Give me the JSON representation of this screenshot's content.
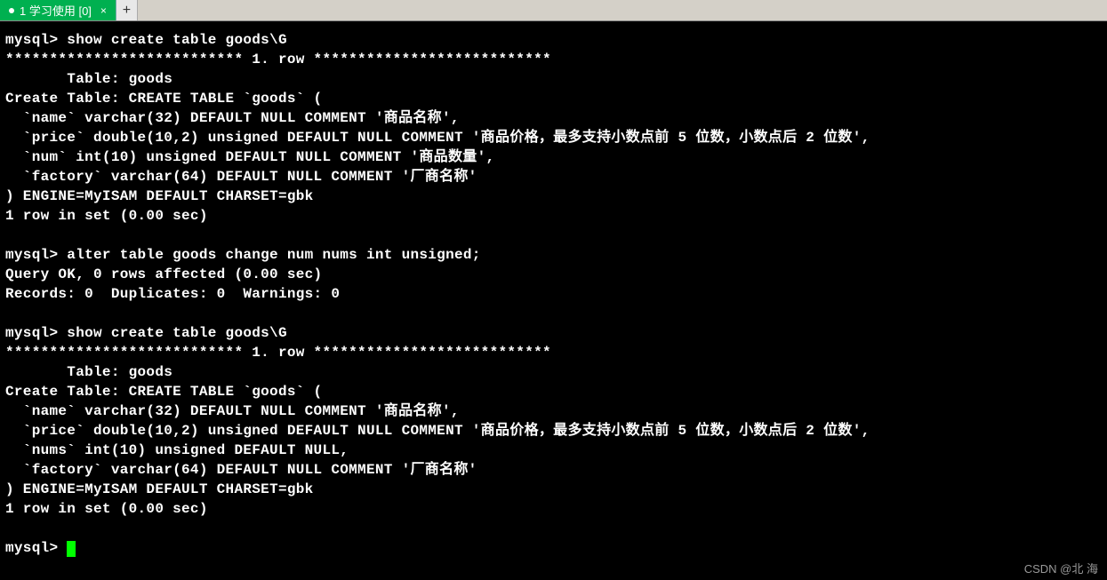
{
  "tab": {
    "label": "1 学习使用 [0]",
    "close_glyph": "×"
  },
  "add_tab_glyph": "+",
  "terminal": {
    "lines": [
      "mysql> show create table goods\\G",
      "*************************** 1. row ***************************",
      "       Table: goods",
      "Create Table: CREATE TABLE `goods` (",
      "  `name` varchar(32) DEFAULT NULL COMMENT '商品名称',",
      "  `price` double(10,2) unsigned DEFAULT NULL COMMENT '商品价格，最多支持小数点前 5 位数，小数点后 2 位数',",
      "  `num` int(10) unsigned DEFAULT NULL COMMENT '商品数量',",
      "  `factory` varchar(64) DEFAULT NULL COMMENT '厂商名称'",
      ") ENGINE=MyISAM DEFAULT CHARSET=gbk",
      "1 row in set (0.00 sec)",
      "",
      "mysql> alter table goods change num nums int unsigned;",
      "Query OK, 0 rows affected (0.00 sec)",
      "Records: 0  Duplicates: 0  Warnings: 0",
      "",
      "mysql> show create table goods\\G",
      "*************************** 1. row ***************************",
      "       Table: goods",
      "Create Table: CREATE TABLE `goods` (",
      "  `name` varchar(32) DEFAULT NULL COMMENT '商品名称',",
      "  `price` double(10,2) unsigned DEFAULT NULL COMMENT '商品价格，最多支持小数点前 5 位数，小数点后 2 位数',",
      "  `nums` int(10) unsigned DEFAULT NULL,",
      "  `factory` varchar(64) DEFAULT NULL COMMENT '厂商名称'",
      ") ENGINE=MyISAM DEFAULT CHARSET=gbk",
      "1 row in set (0.00 sec)",
      "",
      "mysql> "
    ]
  },
  "watermark": "CSDN @北   海"
}
